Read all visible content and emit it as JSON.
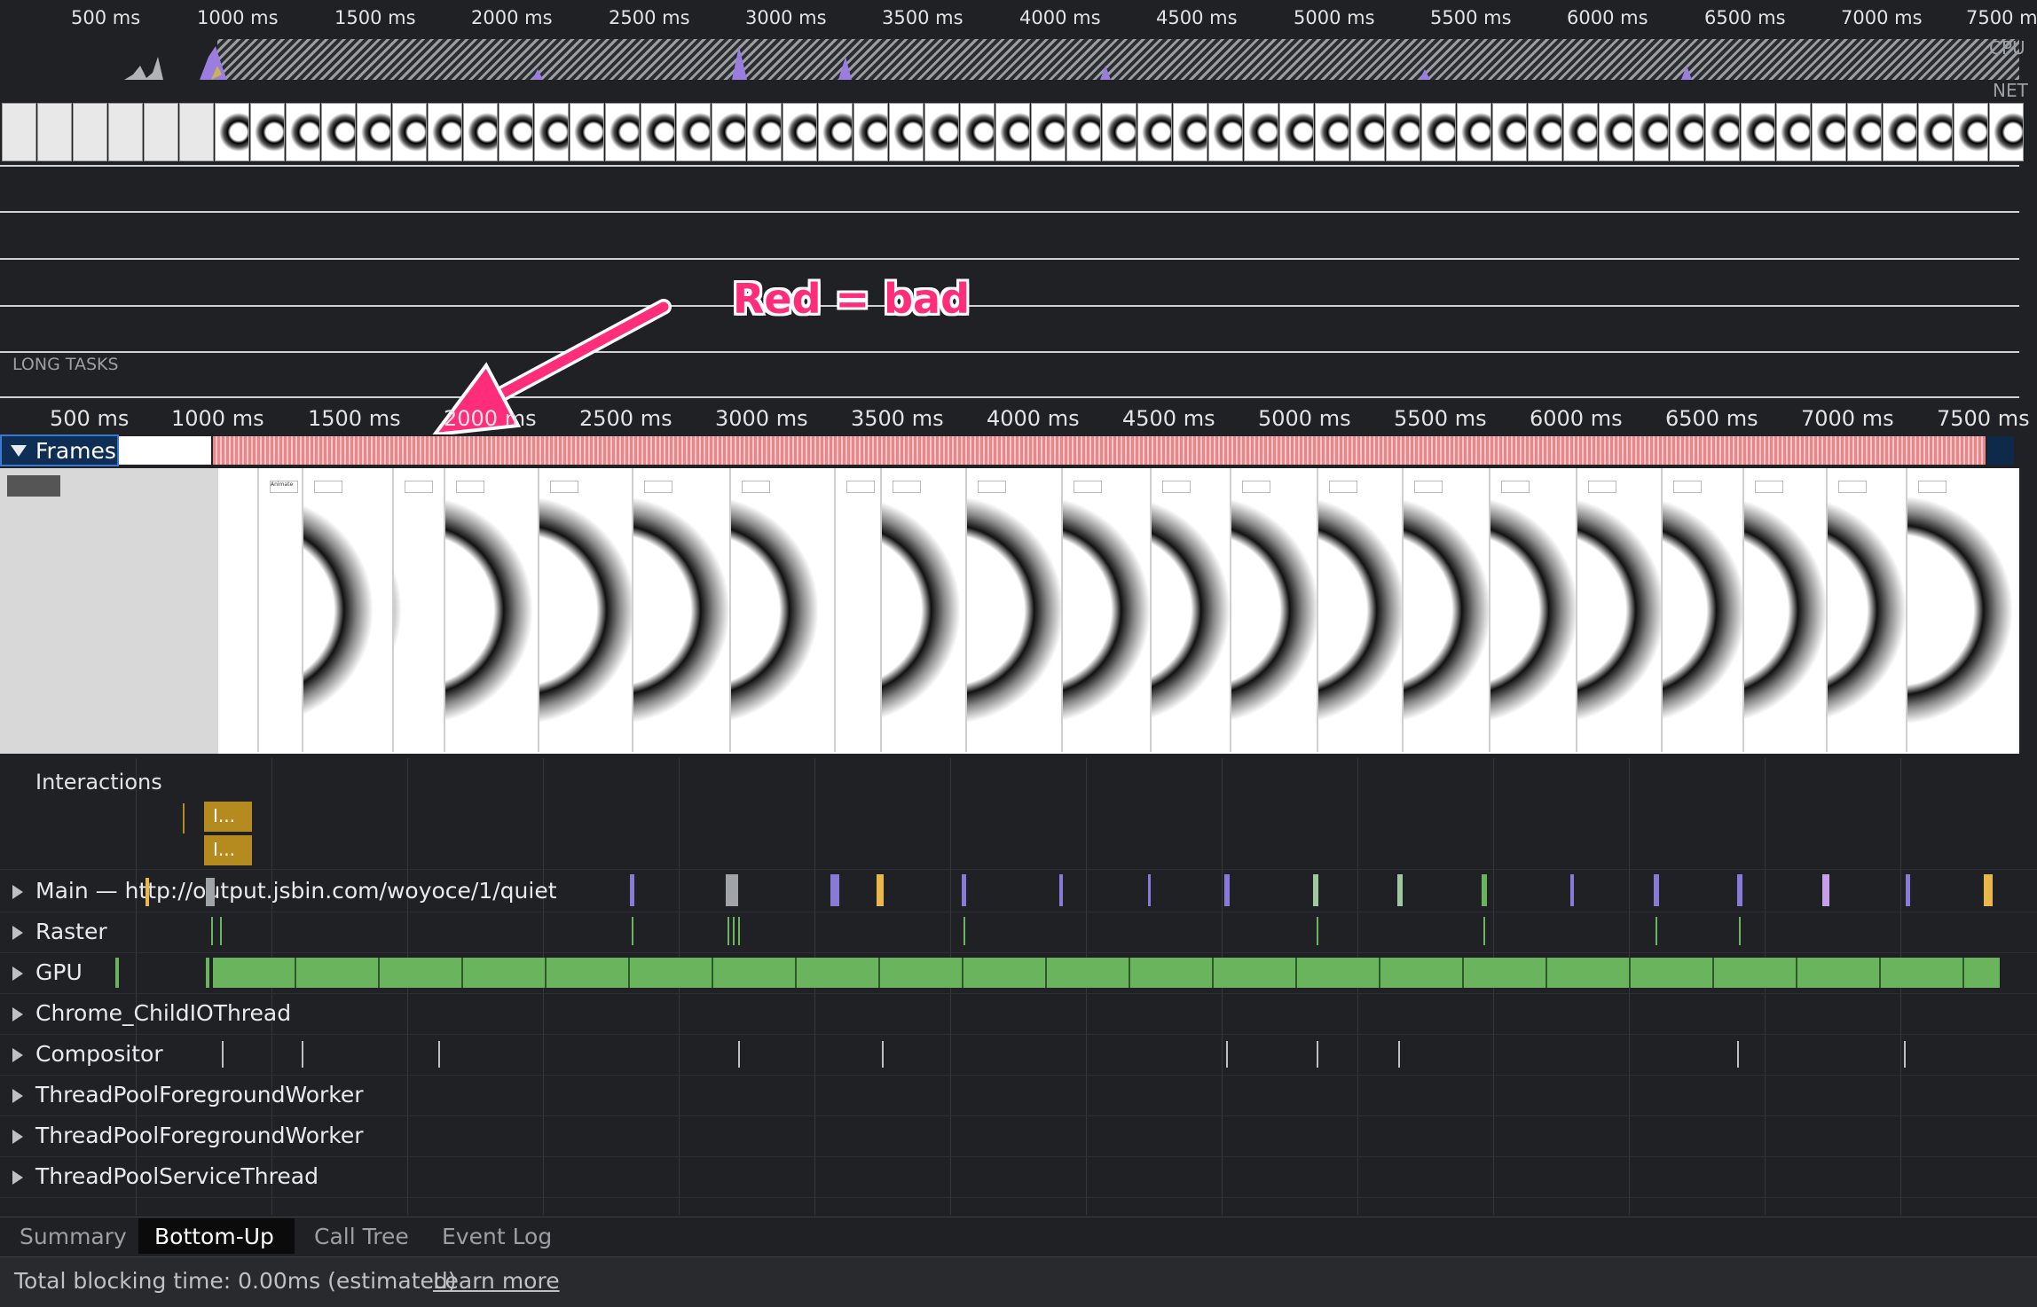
{
  "overview_ruler": {
    "ticks": [
      "500 ms",
      "1000 ms",
      "1500 ms",
      "2000 ms",
      "2500 ms",
      "3000 ms",
      "3500 ms",
      "4000 ms",
      "4500 ms",
      "5000 ms",
      "5500 ms",
      "6000 ms",
      "6500 ms",
      "7000 ms",
      "7500 ms"
    ],
    "cpu_label": "CPU",
    "net_label": "NET"
  },
  "long_tasks_label": "LONG TASKS",
  "annotation": {
    "text": "Red = bad",
    "color": "#ff2d7a"
  },
  "main_ruler": {
    "ticks": [
      "500 ms",
      "1000 ms",
      "1500 ms",
      "2000 ms",
      "2500 ms",
      "3000 ms",
      "3500 ms",
      "4000 ms",
      "4500 ms",
      "5000 ms",
      "5500 ms",
      "6000 ms",
      "6500 ms",
      "7000 ms",
      "7500 ms"
    ]
  },
  "tracks": {
    "frames_label": "Frames",
    "interactions_label": "Interactions",
    "interaction_chip_1": "I...",
    "interaction_chip_2": "I...",
    "main_label": "Main — http://output.jsbin.com/woyoce/1/quiet",
    "raster_label": "Raster",
    "gpu_label": "GPU",
    "childio_label": "Chrome_ChildIOThread",
    "compositor_label": "Compositor",
    "worker1_label": "ThreadPoolForegroundWorker",
    "worker2_label": "ThreadPoolForegroundWorker",
    "service_label": "ThreadPoolServiceThread"
  },
  "screenshot_text": {
    "animate": "Animate",
    "box_text": "I am a box. Aren't I lovely?"
  },
  "bottom_tabs": [
    "Summary",
    "Bottom-Up",
    "Call Tree",
    "Event Log"
  ],
  "active_tab": "Bottom-Up",
  "status": {
    "text": "Total blocking time: 0.00ms (estimated)",
    "link": "Learn more"
  },
  "colors": {
    "background": "#202124",
    "gpu_green": "#6bb45e",
    "frame_red": "#e8868a",
    "interaction_gold": "#b58a1e",
    "active_tab_bg": "#0b0b0b"
  }
}
